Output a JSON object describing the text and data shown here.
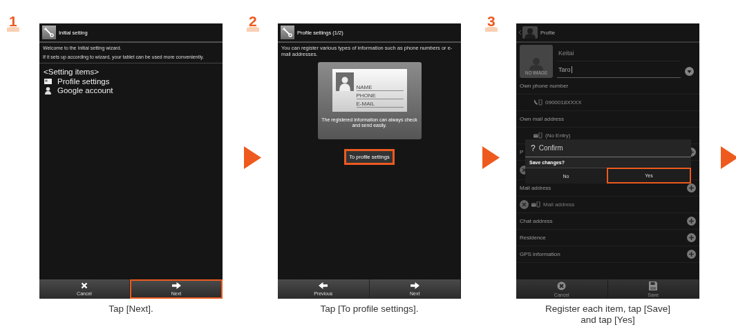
{
  "steps": [
    {
      "number": "1",
      "caption": "Tap [Next].",
      "screen": {
        "kind": "wizard",
        "title": "Initial setting",
        "paragraphs": [
          "Welcome to the Initial setting wizard.",
          "If it sets up according to wizard, your tablet can be used more conveniently."
        ],
        "list_heading": "<Setting items>",
        "items": [
          {
            "label": "Profile settings",
            "kind": "card"
          },
          {
            "label": "Google account",
            "kind": "person"
          }
        ],
        "bottom_buttons": [
          {
            "label": "Cancel",
            "kind": "cancel",
            "highlighted": false
          },
          {
            "label": "Next",
            "kind": "next",
            "highlighted": true
          }
        ]
      }
    },
    {
      "number": "2",
      "caption": "Tap [To profile settings].",
      "screen": {
        "kind": "intro",
        "title": "Profile settings (1/2)",
        "description": "You can register various types of information such as phone numbers or e-mail addresses.",
        "illustration": {
          "fields": [
            "NAME",
            "PHONE",
            "E-MAIL"
          ],
          "caption": "The registered information can always check and send easily."
        },
        "action_button": {
          "label": "To profile settings",
          "highlighted": true
        },
        "bottom_buttons": [
          {
            "label": "Previous",
            "kind": "previous",
            "highlighted": false
          },
          {
            "label": "Next",
            "kind": "next",
            "highlighted": false
          }
        ]
      }
    },
    {
      "number": "3",
      "caption": "Register each item, tap [Save] and tap [Yes]",
      "screen": {
        "kind": "profile",
        "title": "Profile",
        "photo_label": "NO IMAGE",
        "name_fields": [
          {
            "value": "Keitai",
            "focused": false
          },
          {
            "value": "Taro",
            "focused": true
          }
        ],
        "sections": [
          {
            "heading": "Own phone number",
            "addable": false,
            "entries": [
              {
                "kind": "phone",
                "value": "0900018XXXX"
              }
            ]
          },
          {
            "heading": "Own mail address",
            "addable": false,
            "entries": [
              {
                "kind": "mail",
                "value": "(No Entry)"
              }
            ]
          },
          {
            "heading": "P",
            "addable": true,
            "entries": [
              {
                "kind": "stub"
              }
            ]
          },
          {
            "heading": "Mail address",
            "addable": true,
            "entries": [
              {
                "kind": "mail_input",
                "placeholder": "Mail address"
              }
            ]
          },
          {
            "heading": "Chat address",
            "addable": true
          },
          {
            "heading": "Residence",
            "addable": true
          },
          {
            "heading": "GPS information",
            "addable": true
          }
        ],
        "dialog": {
          "title_icon": "?",
          "title": "Confirm",
          "message": "Save changes?",
          "buttons": [
            {
              "label": "No",
              "highlighted": false
            },
            {
              "label": "Yes",
              "highlighted": true
            }
          ]
        },
        "bottom_buttons": [
          {
            "label": "Cancel",
            "kind": "cancel_circle",
            "highlighted": false
          },
          {
            "label": "Save",
            "kind": "save",
            "highlighted": false
          }
        ]
      }
    }
  ]
}
